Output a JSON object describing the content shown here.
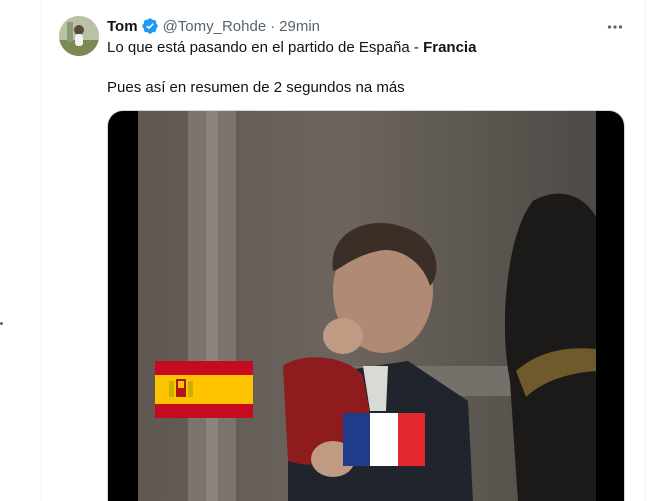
{
  "tweet": {
    "author": {
      "display_name": "Tom",
      "handle": "@Tomy_Rohde",
      "verified": true,
      "avatar_icon": "avatar-image"
    },
    "separator": "·",
    "timestamp": "29min",
    "more_icon": "more-horizontal-icon",
    "text": {
      "line1_prefix": "Lo que está pasando en el partido de España - ",
      "line1_bold": "Francia",
      "line2": "Pues así en resumen de 2 segundos na más"
    },
    "media": {
      "type": "video",
      "overlays": [
        "spain-flag",
        "france-flag"
      ]
    }
  },
  "colors": {
    "accent_verified": "#1d9bf0",
    "text_secondary": "#536471",
    "border": "#cfd9de"
  }
}
